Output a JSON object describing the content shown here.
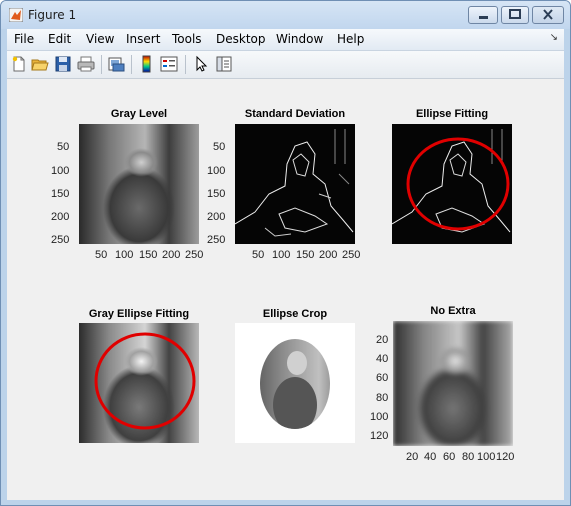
{
  "window": {
    "title": "Figure 1",
    "icon": "matlab-icon"
  },
  "menu": [
    "File",
    "Edit",
    "View",
    "Insert",
    "Tools",
    "Desktop",
    "Window",
    "Help"
  ],
  "menu_arrow": "↘",
  "toolbar_icons": [
    "new-figure-icon",
    "open-file-icon",
    "save-icon",
    "print-icon",
    "print-preview-icon",
    "insert-colorbar-icon",
    "insert-legend-icon",
    "edit-plot-arrow-icon",
    "show-plot-tools-icon"
  ],
  "plots": {
    "gray_level": {
      "title": "Gray Level",
      "yticks": [
        "50",
        "100",
        "150",
        "200",
        "250"
      ],
      "xticks": [
        "50",
        "100",
        "150",
        "200",
        "250"
      ]
    },
    "std_dev": {
      "title": "Standard Deviation",
      "yticks": [
        "50",
        "100",
        "150",
        "200",
        "250"
      ],
      "xticks": [
        "50",
        "100",
        "150",
        "200",
        "250"
      ]
    },
    "ellipse_fitting": {
      "title": "Ellipse Fitting"
    },
    "gray_ellipse": {
      "title": "Gray Ellipse Fitting"
    },
    "ellipse_crop": {
      "title": "Ellipse Crop"
    },
    "no_extra": {
      "title": "No Extra",
      "yticks": [
        "20",
        "40",
        "60",
        "80",
        "100",
        "120"
      ],
      "xticks": [
        "20",
        "40",
        "60",
        "80",
        "100",
        "120"
      ]
    }
  },
  "colors": {
    "ellipse": "#e00000",
    "figure_bg": "#f0f0f0"
  }
}
